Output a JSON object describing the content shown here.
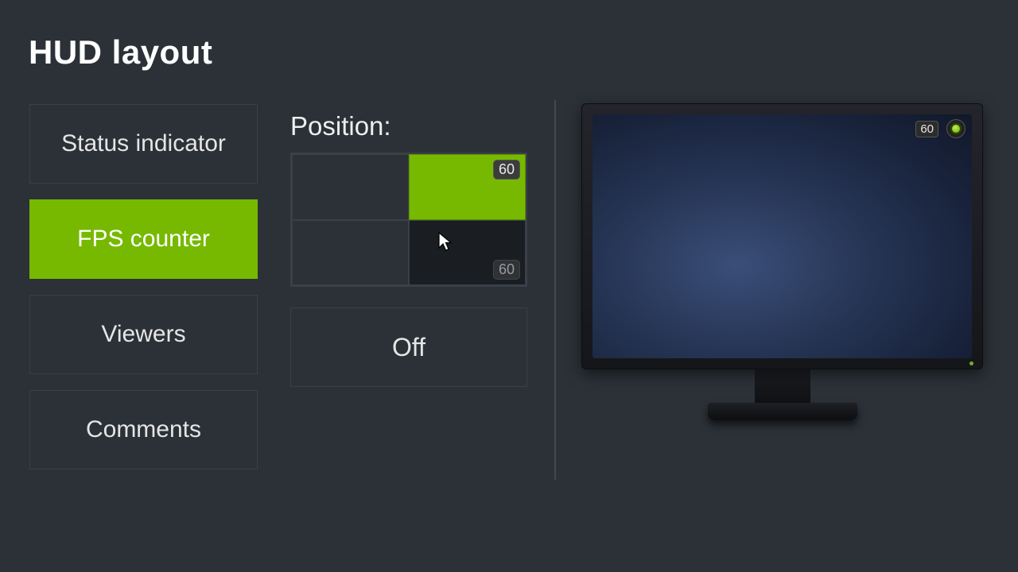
{
  "title": "HUD layout",
  "options": [
    {
      "label": "Status indicator",
      "selected": false
    },
    {
      "label": "FPS counter",
      "selected": true
    },
    {
      "label": "Viewers",
      "selected": false
    },
    {
      "label": "Comments",
      "selected": false
    }
  ],
  "position": {
    "label": "Position:",
    "selected": "top-right",
    "hover": "bottom-right",
    "fps_value": "60",
    "off_label": "Off"
  },
  "preview": {
    "fps_value": "60",
    "status_icon": "status-indicator-icon"
  },
  "colors": {
    "accent": "#76b900",
    "bg": "#2b3137"
  }
}
